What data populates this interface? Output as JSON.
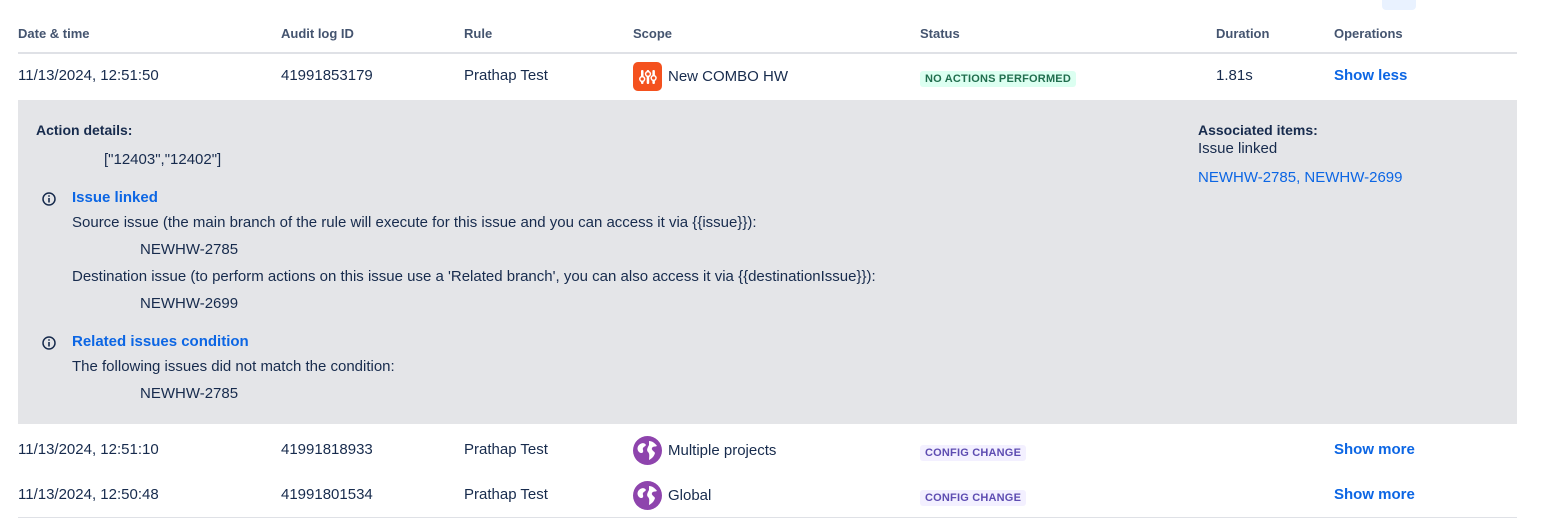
{
  "columns": {
    "date": "Date & time",
    "audit_id": "Audit log ID",
    "rule": "Rule",
    "scope": "Scope",
    "status": "Status",
    "duration": "Duration",
    "operations": "Operations"
  },
  "rows": [
    {
      "date": "11/13/2024, 12:51:50",
      "audit_id": "41991853179",
      "rule": "Prathap Test",
      "scope": "New COMBO HW",
      "scope_icon": "project-avatar-icon",
      "status": "NO ACTIONS PERFORMED",
      "duration": "1.81s",
      "operation": "Show less"
    },
    {
      "date": "11/13/2024, 12:51:10",
      "audit_id": "41991818933",
      "rule": "Prathap Test",
      "scope": "Multiple projects",
      "scope_icon": "globe-icon",
      "status": "CONFIG CHANGE",
      "duration": "",
      "operation": "Show more"
    },
    {
      "date": "11/13/2024, 12:50:48",
      "audit_id": "41991801534",
      "rule": "Prathap Test",
      "scope": "Global",
      "scope_icon": "globe-icon",
      "status": "CONFIG CHANGE",
      "duration": "",
      "operation": "Show more"
    }
  ],
  "details": {
    "action_label": "Action details:",
    "action_value": "[\"12403\",\"12402\"]",
    "sections": [
      {
        "title": "Issue linked",
        "lines": [
          "Source issue (the main branch of the rule will execute for this issue and you can access it via {{issue}}):",
          "NEWHW-2785",
          "Destination issue (to perform actions on this issue use a 'Related branch', you can also access it via {{destinationIssue}}):",
          "NEWHW-2699"
        ]
      },
      {
        "title": "Related issues condition",
        "lines": [
          "The following issues did not match the condition:",
          "NEWHW-2785"
        ]
      }
    ],
    "associated_label": "Associated items:",
    "associated_type": "Issue linked",
    "associated_links": "NEWHW-2785, NEWHW-2699"
  },
  "colors": {
    "link": "#0c66e4",
    "panel_bg": "#e4e5e8",
    "status_green_bg": "#dcfff1",
    "status_green_text": "#216e4e",
    "status_purple_bg": "#f3f0ff",
    "status_purple_text": "#5e4db2",
    "scope_orange": "#f4511e",
    "scope_purple": "#8e44ad"
  }
}
